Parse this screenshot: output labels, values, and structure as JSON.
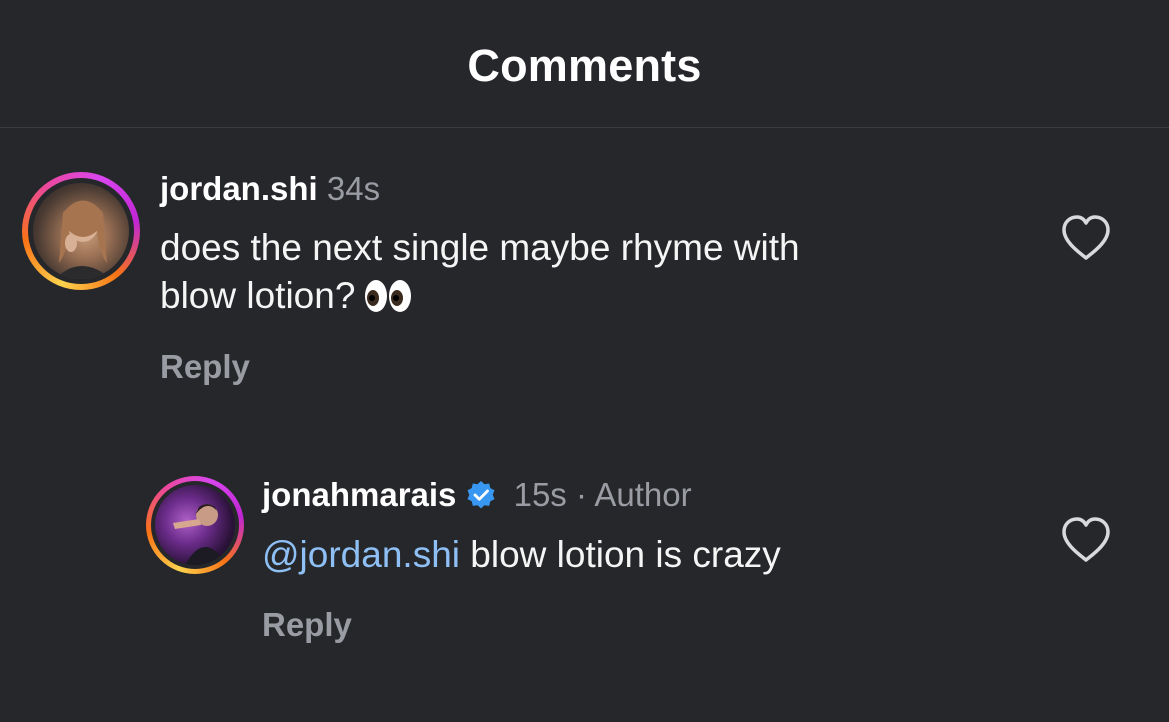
{
  "header": {
    "title": "Comments"
  },
  "comments": [
    {
      "username": "jordan.shi",
      "time": "34s",
      "text_line1": "does the next single maybe rhyme with",
      "text_line2": "blow lotion?",
      "emoji": "eyes-emoji",
      "reply_label": "Reply",
      "like_icon": "heart-outline-icon"
    },
    {
      "username": "jonahmarais",
      "verified": true,
      "time": "15s",
      "separator": "·",
      "author_label": "Author",
      "mention": "@jordan.shi",
      "text": "blow lotion is crazy",
      "reply_label": "Reply",
      "like_icon": "heart-outline-icon"
    }
  ],
  "colors": {
    "background": "#26272b",
    "muted": "#9a9ca3",
    "mention": "#8fc0f5",
    "verified": "#3897f0"
  }
}
